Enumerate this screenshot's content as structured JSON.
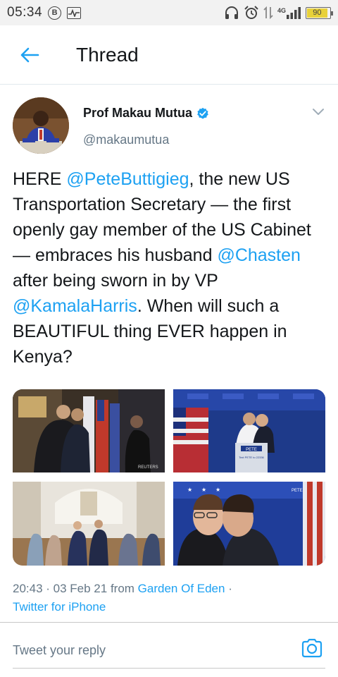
{
  "status_bar": {
    "time": "05:34",
    "b_icon": "B",
    "network": "4G",
    "battery_percent": 90,
    "battery_label": "90"
  },
  "header": {
    "title": "Thread",
    "back_icon": "arrow-left-icon"
  },
  "author": {
    "name": "Prof Makau Mutua",
    "handle": "@makaumutua",
    "verified": true
  },
  "tweet": {
    "t1": "HERE ",
    "m1": "@PeteButtigieg",
    "t2": ", the new US Transportation Secretary — the first openly gay member of the US Cabinet — embraces his husband ",
    "m2": "@Chasten",
    "t3": " after being sworn in by VP ",
    "m3": "@KamalaHarris",
    "t4": ".  When will such a BEAUTIFUL thing EVER happen in Kenya?"
  },
  "media": {
    "watermark": "REUTERS",
    "podium_sign": "PETE",
    "podium_sub": "Text PETE to 22336",
    "banner": "PETE"
  },
  "meta": {
    "time": "20:43",
    "sep1": " · ",
    "date": "03 Feb 21",
    "from": " from ",
    "source": "Garden Of Eden",
    "sep2": " · ",
    "client": "Twitter for iPhone"
  },
  "reply": {
    "placeholder": "Tweet your reply"
  },
  "colors": {
    "accent": "#1da1f2",
    "secondary_text": "#657786",
    "battery": "#e8d13a"
  }
}
